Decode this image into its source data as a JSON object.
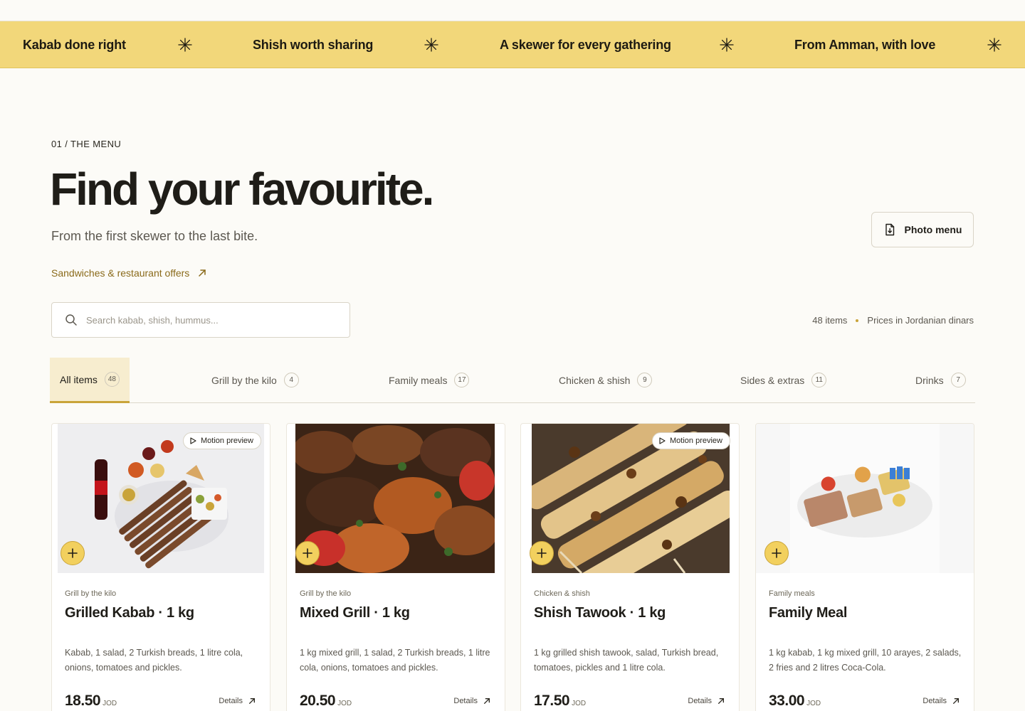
{
  "ticker": {
    "messages": [
      "Kabab done right",
      "Shish worth sharing",
      "A skewer for every gathering",
      "From Amman, with love"
    ]
  },
  "section": {
    "eyebrow": "01 / THE MENU",
    "title": "Find your favourite.",
    "subtitle": "From the first skewer to the last bite.",
    "offers_link": "Sandwiches & restaurant offers",
    "photo_menu_label": "Photo menu"
  },
  "search": {
    "placeholder": "Search kabab, shish, hummus...",
    "value": ""
  },
  "meta": {
    "items_count": "48 items",
    "prices_note": "Prices in Jordanian dinars"
  },
  "tabs": [
    {
      "label": "All items",
      "count": "48",
      "active": true
    },
    {
      "label": "Grill by the kilo",
      "count": "4",
      "active": false
    },
    {
      "label": "Family meals",
      "count": "17",
      "active": false
    },
    {
      "label": "Chicken & shish",
      "count": "9",
      "active": false
    },
    {
      "label": "Sides & extras",
      "count": "11",
      "active": false
    },
    {
      "label": "Drinks",
      "count": "7",
      "active": false
    }
  ],
  "cards": [
    {
      "category": "Grill by the kilo",
      "name": "Grilled Kabab · 1 kg",
      "description": "Kabab, 1 salad, 2 Turkish breads, 1 litre cola, onions, tomatoes and pickles.",
      "price": "18.50",
      "currency": "JOD",
      "details_label": "Details",
      "motion_label": "Motion preview",
      "has_motion": true
    },
    {
      "category": "Grill by the kilo",
      "name": "Mixed Grill · 1 kg",
      "description": "1 kg mixed grill, 1 salad, 2 Turkish breads, 1 litre cola, onions, tomatoes and pickles.",
      "price": "20.50",
      "currency": "JOD",
      "details_label": "Details",
      "has_motion": false
    },
    {
      "category": "Chicken & shish",
      "name": "Shish Tawook · 1 kg",
      "description": "1 kg grilled shish tawook, salad, Turkish bread, tomatoes, pickles and 1 litre cola.",
      "price": "17.50",
      "currency": "JOD",
      "details_label": "Details",
      "motion_label": "Motion preview",
      "has_motion": true
    },
    {
      "category": "Family meals",
      "name": "Family Meal",
      "description": "1 kg kabab, 1 kg mixed grill, 10 arayes, 2 salads, 2 fries and 2 litres Coca-Cola.",
      "price": "33.00",
      "currency": "JOD",
      "details_label": "Details",
      "has_motion": false
    }
  ],
  "colors": {
    "accent": "#f2d77a",
    "accent_dark": "#c9a43a",
    "link": "#8a6a1a",
    "background": "#fcfbf7"
  }
}
